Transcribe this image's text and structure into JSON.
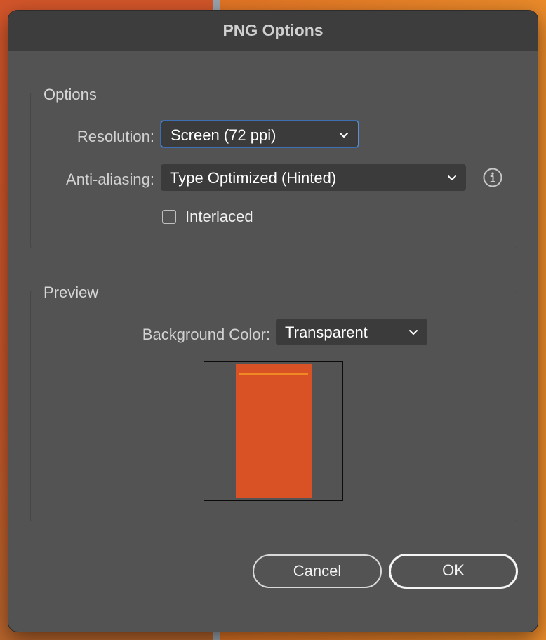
{
  "dialog": {
    "title": "PNG Options"
  },
  "options_group": {
    "label": "Options",
    "resolution": {
      "label": "Resolution:",
      "value": "Screen (72 ppi)"
    },
    "anti_aliasing": {
      "label": "Anti-aliasing:",
      "value": "Type Optimized (Hinted)",
      "info_icon": "info-circle-icon"
    },
    "interlaced": {
      "label": "Interlaced",
      "checked": false
    }
  },
  "preview_group": {
    "label": "Preview",
    "background_color": {
      "label": "Background Color:",
      "value": "Transparent"
    },
    "artwork_colors": {
      "fill": "#d95226",
      "stripe": "#ef8a22"
    }
  },
  "buttons": {
    "cancel": "Cancel",
    "ok": "OK"
  },
  "colors": {
    "dialog_bg": "#535353",
    "titlebar_bg": "#3d3d3d",
    "focus_ring": "#5b8fd6"
  }
}
